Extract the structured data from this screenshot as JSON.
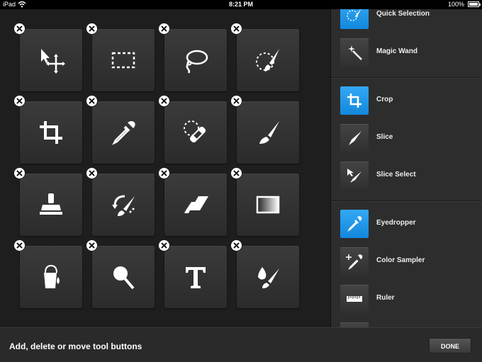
{
  "status_bar": {
    "carrier": "iPad",
    "time": "8:21 PM",
    "battery": "100%"
  },
  "grid": {
    "tiles": [
      {
        "name": "move-tool",
        "icon": "move-icon"
      },
      {
        "name": "marquee-tool",
        "icon": "marquee-icon"
      },
      {
        "name": "lasso-tool",
        "icon": "lasso-icon"
      },
      {
        "name": "quick-selection-tool",
        "icon": "quick-selection-icon"
      },
      {
        "name": "crop-tool",
        "icon": "crop-icon"
      },
      {
        "name": "eyedropper-tool",
        "icon": "eyedropper-icon"
      },
      {
        "name": "healing-tool",
        "icon": "bandage-icon"
      },
      {
        "name": "brush-tool",
        "icon": "brush-icon"
      },
      {
        "name": "stamp-tool",
        "icon": "stamp-icon"
      },
      {
        "name": "history-brush-tool",
        "icon": "history-brush-icon"
      },
      {
        "name": "eraser-tool",
        "icon": "eraser-icon"
      },
      {
        "name": "gradient-tool",
        "icon": "gradient-icon"
      },
      {
        "name": "paint-bucket-tool",
        "icon": "paint-bucket-icon"
      },
      {
        "name": "zoom-tool",
        "icon": "magnifier-icon"
      },
      {
        "name": "type-tool",
        "icon": "type-icon"
      },
      {
        "name": "smudge-tool",
        "icon": "smudge-icon"
      }
    ]
  },
  "panel": {
    "items": [
      {
        "label": "Quick Selection",
        "active": true,
        "icon": "quick-selection-icon"
      },
      {
        "label": "Magic Wand",
        "active": false,
        "icon": "magic-wand-icon"
      },
      {
        "label": "Crop",
        "active": true,
        "icon": "crop-icon"
      },
      {
        "label": "Slice",
        "active": false,
        "icon": "slice-icon"
      },
      {
        "label": "Slice Select",
        "active": false,
        "icon": "slice-select-icon"
      },
      {
        "label": "Eyedropper",
        "active": true,
        "icon": "eyedropper-icon"
      },
      {
        "label": "Color Sampler",
        "active": false,
        "icon": "color-sampler-icon"
      },
      {
        "label": "Ruler",
        "active": false,
        "icon": "ruler-icon"
      }
    ]
  },
  "bottom": {
    "hint": "Add, delete or move tool buttons",
    "done_label": "DONE"
  },
  "colors": {
    "accent": "#1e96e8",
    "tile": "#333333",
    "panel": "#2d2d2d"
  }
}
